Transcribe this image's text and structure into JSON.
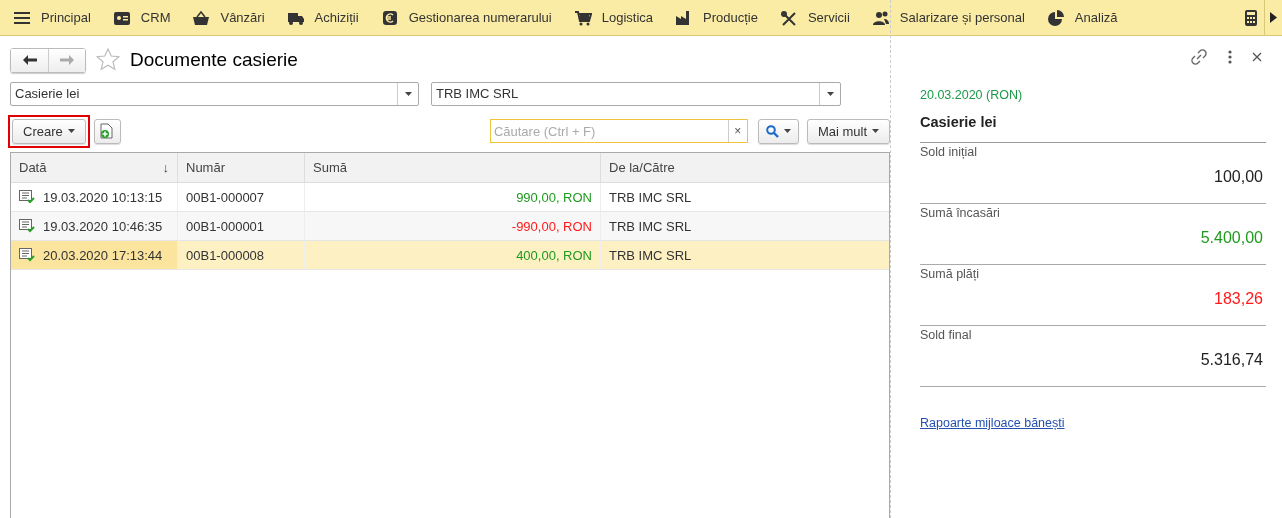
{
  "menu": [
    {
      "label": "Principal"
    },
    {
      "label": "CRM"
    },
    {
      "label": "Vânzări"
    },
    {
      "label": "Achiziții"
    },
    {
      "label": "Gestionarea numerarului"
    },
    {
      "label": "Logistica"
    },
    {
      "label": "Producție"
    },
    {
      "label": "Servicii"
    },
    {
      "label": "Salarizare și personal"
    },
    {
      "label": "Analiză"
    }
  ],
  "window": {
    "title": "Documente casierie",
    "starred": false
  },
  "filters": [
    {
      "value": "Casierie lei"
    },
    {
      "value": "TRB IMC SRL"
    }
  ],
  "toolbar": {
    "create": {
      "label": "Creare",
      "highlighted": true
    },
    "search": {
      "placeholder": "Căutare (Ctrl + F)",
      "clear": "×"
    },
    "more": {
      "label": "Mai mult"
    }
  },
  "table": {
    "columns": [
      {
        "label": "Dată",
        "sort_mark": "↓"
      },
      {
        "label": "Număr"
      },
      {
        "label": "Sumă"
      },
      {
        "label": "De la/Către"
      }
    ],
    "rows": [
      {
        "date": "19.03.2020 10:13:15",
        "number": "00B1-000007",
        "amount": "990,00, RON",
        "kind": "income",
        "party": "TRB IMC SRL",
        "selected": false
      },
      {
        "date": "19.03.2020 10:46:35",
        "number": "00B1-000001",
        "amount": "-990,00, RON",
        "kind": "expense",
        "party": "TRB IMC SRL",
        "selected": false
      },
      {
        "date": "20.03.2020 17:13:44",
        "number": "00B1-000008",
        "amount": "400,00, RON",
        "kind": "income",
        "party": "TRB IMC SRL",
        "selected": true
      }
    ]
  },
  "summary": {
    "date": "20.03.2020 (RON)",
    "title": "Casierie lei",
    "items": [
      {
        "label": "Sold inițial",
        "value": "100,00",
        "kind": "neutral"
      },
      {
        "label": "Sumă încasări",
        "value": "5.400,00",
        "kind": "income"
      },
      {
        "label": "Sumă plăți",
        "value": "183,26",
        "kind": "expense"
      },
      {
        "label": "Sold final",
        "value": "5.316,74",
        "kind": "neutral"
      }
    ],
    "link": "Rapoarte mijloace bănești"
  }
}
